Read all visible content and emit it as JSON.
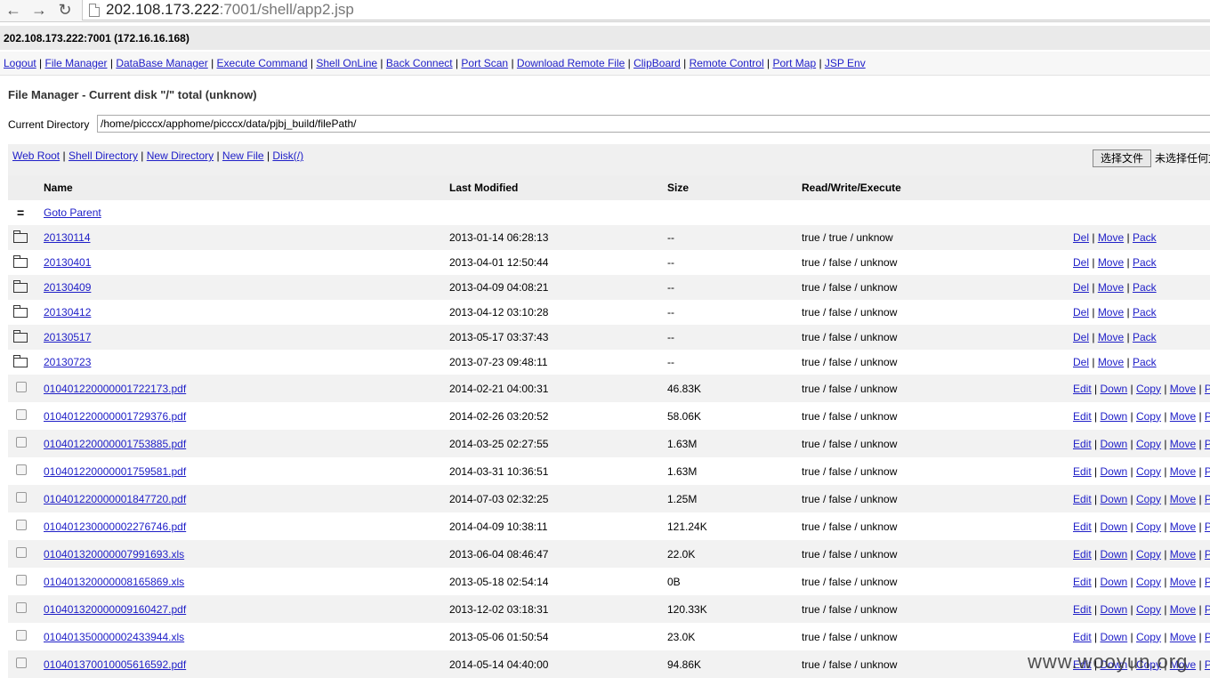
{
  "browser": {
    "url_host": "202.108.173.222",
    "url_rest": ":7001/shell/app2.jsp"
  },
  "server": {
    "title": "202.108.173.222:7001 (172.16.16.168)"
  },
  "menu": [
    "Logout",
    "File Manager",
    "DataBase Manager",
    "Execute Command",
    "Shell OnLine",
    "Back Connect",
    "Port Scan",
    "Download Remote File",
    "ClipBoard",
    "Remote Control",
    "Port Map",
    "JSP Env"
  ],
  "file_manager": {
    "title": "File Manager - Current disk \"/\" total (unknow)",
    "current_dir_label": "Current Directory",
    "current_dir_value": "/home/picccx/apphome/picccx/data/pjbj_build/filePath/",
    "toolbar": [
      "Web Root",
      "Shell Directory",
      "New Directory",
      "New File",
      "Disk(/)"
    ],
    "file_button": "选择文件",
    "file_none": "未选择任何文件",
    "headers": {
      "name": "Name",
      "modified": "Last Modified",
      "size": "Size",
      "perm": "Read/Write/Execute"
    },
    "parent": "Goto Parent",
    "dir_actions": [
      "Del",
      "Move",
      "Pack"
    ],
    "file_actions": [
      "Edit",
      "Down",
      "Copy",
      "Move",
      "Pack"
    ],
    "dirs": [
      {
        "name": "20130114",
        "modified": "2013-01-14 06:28:13",
        "size": "--",
        "perm": "true / true / unknow"
      },
      {
        "name": "20130401",
        "modified": "2013-04-01 12:50:44",
        "size": "--",
        "perm": "true / false / unknow"
      },
      {
        "name": "20130409",
        "modified": "2013-04-09 04:08:21",
        "size": "--",
        "perm": "true / false / unknow"
      },
      {
        "name": "20130412",
        "modified": "2013-04-12 03:10:28",
        "size": "--",
        "perm": "true / false / unknow"
      },
      {
        "name": "20130517",
        "modified": "2013-05-17 03:37:43",
        "size": "--",
        "perm": "true / false / unknow"
      },
      {
        "name": "20130723",
        "modified": "2013-07-23 09:48:11",
        "size": "--",
        "perm": "true / false / unknow"
      }
    ],
    "files": [
      {
        "name": "010401220000001722173.pdf",
        "modified": "2014-02-21 04:00:31",
        "size": "46.83K",
        "perm": "true / false / unknow"
      },
      {
        "name": "010401220000001729376.pdf",
        "modified": "2014-02-26 03:20:52",
        "size": "58.06K",
        "perm": "true / false / unknow"
      },
      {
        "name": "010401220000001753885.pdf",
        "modified": "2014-03-25 02:27:55",
        "size": "1.63M",
        "perm": "true / false / unknow"
      },
      {
        "name": "010401220000001759581.pdf",
        "modified": "2014-03-31 10:36:51",
        "size": "1.63M",
        "perm": "true / false / unknow"
      },
      {
        "name": "010401220000001847720.pdf",
        "modified": "2014-07-03 02:32:25",
        "size": "1.25M",
        "perm": "true / false / unknow"
      },
      {
        "name": "010401230000002276746.pdf",
        "modified": "2014-04-09 10:38:11",
        "size": "121.24K",
        "perm": "true / false / unknow"
      },
      {
        "name": "010401320000007991693.xls",
        "modified": "2013-06-04 08:46:47",
        "size": "22.0K",
        "perm": "true / false / unknow"
      },
      {
        "name": "010401320000008165869.xls",
        "modified": "2013-05-18 02:54:14",
        "size": "0B",
        "perm": "true / false / unknow"
      },
      {
        "name": "010401320000009160427.pdf",
        "modified": "2013-12-02 03:18:31",
        "size": "120.33K",
        "perm": "true / false / unknow"
      },
      {
        "name": "010401350000002433944.xls",
        "modified": "2013-05-06 01:50:54",
        "size": "23.0K",
        "perm": "true / false / unknow"
      },
      {
        "name": "010401370010005616592.pdf",
        "modified": "2014-05-14 04:40:00",
        "size": "94.86K",
        "perm": "true / false / unknow"
      }
    ]
  },
  "watermark": "www.wooyun.org"
}
